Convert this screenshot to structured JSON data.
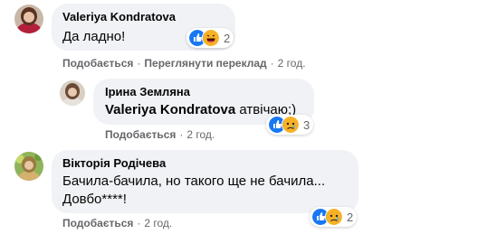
{
  "comments": [
    {
      "author": "Valeriya Kondratova",
      "text": "Да ладно!",
      "reaction_count": "2",
      "reactions": [
        "like-icon",
        "haha-icon"
      ],
      "actions": [
        "Подобається",
        "Переглянути переклад"
      ],
      "time": "2 год."
    },
    {
      "author": "Ірина Земляна",
      "mention": "Valeriya Kondratova",
      "text": " атвічаю;)",
      "reaction_count": "3",
      "reactions": [
        "like-icon",
        "sad-icon"
      ],
      "actions": [
        "Подобається"
      ],
      "time": "2 год."
    },
    {
      "author": "Вікторія Родічева",
      "text_line1": "Бачила-бачила, но такого ще не бачила...",
      "text_line2": "Довбо****!",
      "reaction_count": "2",
      "reactions": [
        "like-icon",
        "sad-icon"
      ],
      "actions": [
        "Подобається"
      ],
      "time": "2 год."
    }
  ],
  "colors": {
    "bubble": "#f0f2f5",
    "meta_text": "#65676b",
    "like_blue": "#1877f2",
    "reaction_yellow": "#f7b125"
  }
}
